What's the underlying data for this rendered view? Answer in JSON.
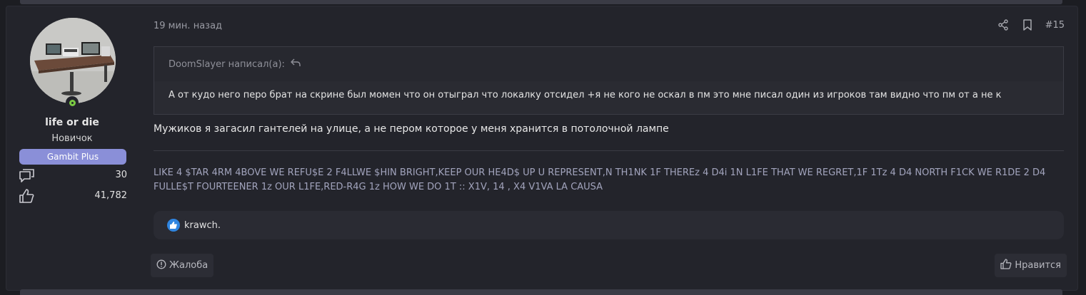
{
  "user": {
    "username": "life or die",
    "title": "Новичок",
    "banner": "Gambit Plus",
    "messages_count": "30",
    "reactions_count": "41,782",
    "online": true
  },
  "post": {
    "time": "19 мин. назад",
    "post_number": "#15",
    "quote": {
      "author_line": "DoomSlayer написал(а):",
      "text": "А от кудо него перо брат на скрине был момен что он отыграл что локалку отсидел +я не кого не оскал в пм это мне писал один из игроков там видно что пм от а не к"
    },
    "message": "Мужиков я загасил гантелей на улице, а не пером которое у меня хранится в потолочной лампе",
    "signature": "LIKE 4 $TAR 4RM 4BOVE WE REFU$E 2 F4LLWE $HIN BRIGHT,KEEP OUR HE4D$ UP U REPRESENT,N TH1NK 1F THEREz 4 D4i 1N L1FE THAT WE REGRET,1F 1Tz 4 D4 NORTH F1CK WE R1DE 2 D4 FULLE$T FOURTEENER 1z OUR L1FE,RED-R4G 1z HOW WE DO 1T :: X1V, 14 , X4 V1VA LA CAUSA",
    "reactions": {
      "users": "krawch."
    },
    "report_label": "Жалоба",
    "like_label": "Нравится"
  },
  "colors": {
    "accent_banner": "#8a8fd8",
    "online": "#7ac943",
    "reaction_badge": "#2f85e0",
    "signature": "#a2a4bd"
  },
  "icons": [
    "online-status-icon",
    "messages-icon",
    "thumbs-up-icon",
    "share-icon",
    "bookmark-icon",
    "quote-jump-icon",
    "like-reaction-icon",
    "report-icon",
    "like-icon"
  ]
}
